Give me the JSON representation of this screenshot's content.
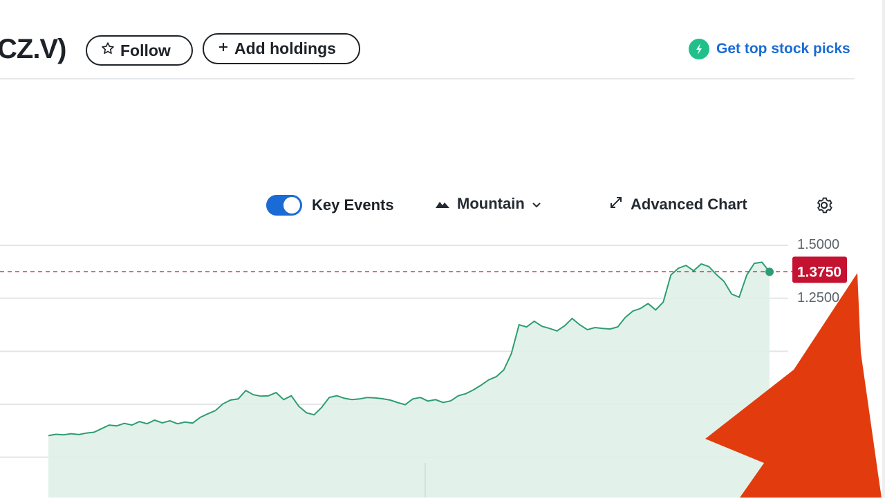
{
  "header": {
    "ticker_title": "CZ.V)",
    "follow_label": "Follow",
    "add_holdings_label": "Add holdings",
    "stock_picks_label": "Get top stock picks"
  },
  "toolbar": {
    "key_events_label": "Key Events",
    "key_events_enabled": true,
    "chart_type_label": "Mountain",
    "advanced_chart_label": "Advanced Chart"
  },
  "icons": {
    "follow": "star-outline-icon",
    "add": "plus-icon",
    "stock_picks": "lightning-badge-icon",
    "mountain": "mountain-icon",
    "dropdown": "chevron-down-icon",
    "advanced": "expand-arrows-icon",
    "settings": "gear-icon"
  },
  "colors": {
    "line": "#2e9c72",
    "fill": "#dff1e8",
    "current_price_marker": "#c41230",
    "accent_blue": "#1a6bd6",
    "badge_green": "#21c08b",
    "arrow": "#e23c0e"
  },
  "chart_data": {
    "type": "area",
    "current_price": 1.375,
    "current_price_label": "1.3750",
    "y_tick_labels": [
      "1.5000",
      "1.2500"
    ],
    "ylim_visible": [
      0.6,
      1.55
    ],
    "grid": true,
    "series": [
      {
        "values": [
          0.602,
          0.608,
          0.606,
          0.611,
          0.607,
          0.614,
          0.618,
          0.635,
          0.652,
          0.648,
          0.66,
          0.652,
          0.668,
          0.658,
          0.675,
          0.662,
          0.672,
          0.658,
          0.666,
          0.661,
          0.688,
          0.705,
          0.72,
          0.752,
          0.77,
          0.775,
          0.815,
          0.795,
          0.788,
          0.79,
          0.805,
          0.772,
          0.79,
          0.74,
          0.71,
          0.7,
          0.735,
          0.782,
          0.79,
          0.778,
          0.772,
          0.775,
          0.782,
          0.78,
          0.776,
          0.77,
          0.758,
          0.748,
          0.775,
          0.782,
          0.765,
          0.772,
          0.758,
          0.766,
          0.79,
          0.8,
          0.818,
          0.84,
          0.865,
          0.88,
          0.912,
          0.99,
          1.125,
          1.115,
          1.142,
          1.118,
          1.108,
          1.096,
          1.12,
          1.155,
          1.125,
          1.102,
          1.112,
          1.108,
          1.105,
          1.115,
          1.16,
          1.19,
          1.202,
          1.225,
          1.195,
          1.232,
          1.36,
          1.392,
          1.405,
          1.38,
          1.412,
          1.4,
          1.362,
          1.33,
          1.27,
          1.255,
          1.36,
          1.415,
          1.42,
          1.375
        ]
      }
    ]
  }
}
